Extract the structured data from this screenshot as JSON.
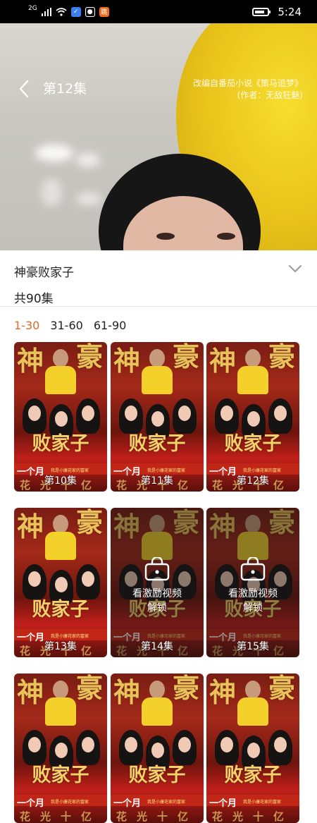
{
  "status_bar": {
    "network": "2G",
    "time": "5:24",
    "app_badge": "跳"
  },
  "video": {
    "episode_title": "第12集",
    "credit_line1": "改编自番茄小说《策马追梦》",
    "credit_line2": "(作者：无敌狂魅)"
  },
  "info": {
    "title": "神豪败家子",
    "episode_count": "共90集"
  },
  "range_tabs": [
    "1-30",
    "31-60",
    "61-90"
  ],
  "poster": {
    "big_left": "神",
    "big_right": "豪",
    "sub": "败家子",
    "yue": "一个月",
    "small": "我是小康花家的富家",
    "hua": "花光十亿"
  },
  "episodes": [
    {
      "label": "第10集",
      "locked": false
    },
    {
      "label": "第11集",
      "locked": false
    },
    {
      "label": "第12集",
      "locked": false
    },
    {
      "label": "第13集",
      "locked": false
    },
    {
      "label": "第14集",
      "locked": true
    },
    {
      "label": "第15集",
      "locked": true
    }
  ],
  "lock_text": "看激励视频解锁",
  "colors": {
    "accent": "#e16a32",
    "status_bar": "#000000"
  }
}
